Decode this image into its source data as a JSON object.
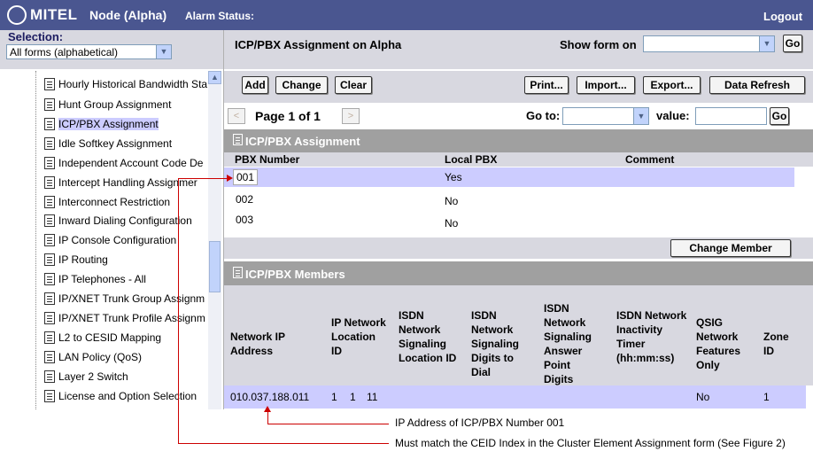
{
  "header": {
    "logo": "MITEL",
    "node_title": "Node (Alpha)",
    "alarm_status_label": "Alarm Status:",
    "logout_label": "Logout"
  },
  "sidebar": {
    "selection_label": "Selection:",
    "forms_select_value": "All forms (alphabetical)",
    "items": [
      {
        "label": "Hourly Historical Bandwidth Sta"
      },
      {
        "label": "Hunt Group Assignment"
      },
      {
        "label": "ICP/PBX Assignment",
        "selected": true
      },
      {
        "label": "Idle Softkey Assignment"
      },
      {
        "label": "Independent Account Code De"
      },
      {
        "label": "Intercept Handling Assignmer"
      },
      {
        "label": "Interconnect Restriction"
      },
      {
        "label": "Inward Dialing Configuration"
      },
      {
        "label": "IP Console Configuration"
      },
      {
        "label": "IP Routing"
      },
      {
        "label": "IP Telephones - All"
      },
      {
        "label": "IP/XNET Trunk Group Assignm"
      },
      {
        "label": "IP/XNET Trunk Profile Assignm"
      },
      {
        "label": "L2 to CESID Mapping"
      },
      {
        "label": "LAN Policy (QoS)"
      },
      {
        "label": "Layer 2 Switch"
      },
      {
        "label": "License and Option Selection"
      }
    ]
  },
  "form": {
    "title": "ICP/PBX Assignment on Alpha",
    "show_form_label": "Show form on",
    "show_form_value": "",
    "go_label": "Go"
  },
  "toolbar": {
    "add": "Add",
    "change": "Change",
    "clear": "Clear",
    "print": "Print...",
    "import": "Import...",
    "export": "Export...",
    "refresh": "Data Refresh"
  },
  "pager": {
    "prev": "<",
    "next": ">",
    "page_text": "Page 1 of 1",
    "goto_label": "Go to:",
    "goto_value": "",
    "value_label": "value:",
    "value_input": "",
    "go_label": "Go"
  },
  "assignment": {
    "section_title": "ICP/PBX Assignment",
    "columns": [
      "PBX Number",
      "Local PBX",
      "Comment"
    ],
    "rows": [
      {
        "pbx_number": "001",
        "local_pbx": "Yes",
        "comment": ""
      },
      {
        "pbx_number": "002",
        "local_pbx": "No",
        "comment": ""
      },
      {
        "pbx_number": "003",
        "local_pbx": "No",
        "comment": ""
      }
    ],
    "change_member_label": "Change Member"
  },
  "members": {
    "section_title": "ICP/PBX Members",
    "columns": [
      "Network IP Address",
      "IP Network Location ID",
      "ISDN Network Signaling Location ID",
      "ISDN Network Signaling Digits to Dial",
      "ISDN Network Signaling Answer Point Digits",
      "ISDN Network Inactivity Timer (hh:mm:ss)",
      "QSIG Network Features Only",
      "Zone ID"
    ],
    "row": {
      "ip": "010.037.188.011",
      "location_id": "1",
      "sig_location_id": "1",
      "digits_to_dial": "11",
      "answer_point": "",
      "inactivity_timer": "",
      "qsig_only": "No",
      "zone_id": "1"
    }
  },
  "annotations": {
    "note1": "IP Address of ICP/PBX Number 001",
    "note2": "Must match the CEID Index in the Cluster Element Assignment form (See Figure 2)"
  },
  "colors": {
    "header_bg": "#4a5690",
    "band_bg": "#d8d8e0",
    "section_bg": "#a0a0a0",
    "selected_row": "#ccccff",
    "annotation_red": "#cc0000"
  }
}
